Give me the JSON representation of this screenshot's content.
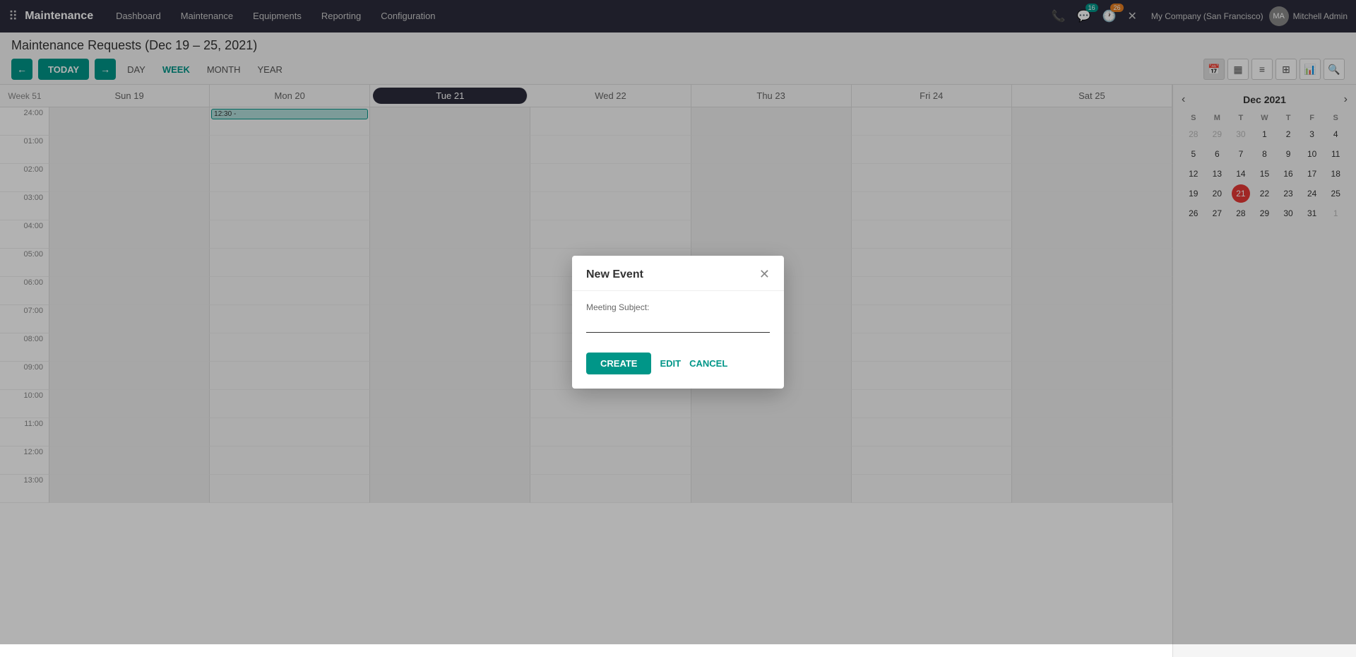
{
  "topnav": {
    "app_name": "Maintenance",
    "menu_items": [
      {
        "label": "Dashboard",
        "active": false
      },
      {
        "label": "Maintenance",
        "active": false
      },
      {
        "label": "Equipments",
        "active": false
      },
      {
        "label": "Reporting",
        "active": false
      },
      {
        "label": "Configuration",
        "active": false
      }
    ],
    "notification_count": "16",
    "chat_count": "26",
    "company": "My Company (San Francisco)",
    "user": "Mitchell Admin"
  },
  "page": {
    "title": "Maintenance Requests (Dec 19 – 25, 2021)",
    "views": [
      "DAY",
      "WEEK",
      "MONTH",
      "YEAR"
    ],
    "active_view": "WEEK"
  },
  "calendar": {
    "week_label": "Week 51",
    "days": [
      {
        "label": "Sun 19",
        "today": false
      },
      {
        "label": "Mon 20",
        "today": false
      },
      {
        "label": "Tue 21",
        "today": true
      },
      {
        "label": "Wed 22",
        "today": false
      },
      {
        "label": "Thu 23",
        "today": false
      },
      {
        "label": "Fri 24",
        "today": false
      },
      {
        "label": "Sat 25",
        "today": false
      }
    ],
    "time_slots": [
      "24:00",
      "01:00",
      "02:00",
      "03:00",
      "04:00",
      "05:00",
      "06:00",
      "07:00",
      "08:00",
      "09:00",
      "10:00",
      "11:00",
      "12:00",
      "13:00"
    ],
    "event": {
      "time": "12:30 -",
      "col": 1,
      "row": 0
    }
  },
  "mini_calendar": {
    "title": "Dec 2021",
    "day_headers": [
      "S",
      "M",
      "T",
      "W",
      "T",
      "F",
      "S"
    ],
    "weeks": [
      [
        {
          "day": "28",
          "other": true
        },
        {
          "day": "29",
          "other": true
        },
        {
          "day": "30",
          "other": true
        },
        {
          "day": "1",
          "other": false
        },
        {
          "day": "2",
          "other": false
        },
        {
          "day": "3",
          "other": false
        },
        {
          "day": "4",
          "other": false
        }
      ],
      [
        {
          "day": "5",
          "other": false
        },
        {
          "day": "6",
          "other": false
        },
        {
          "day": "7",
          "other": false
        },
        {
          "day": "8",
          "other": false
        },
        {
          "day": "9",
          "other": false
        },
        {
          "day": "10",
          "other": false
        },
        {
          "day": "11",
          "other": false
        }
      ],
      [
        {
          "day": "12",
          "other": false
        },
        {
          "day": "13",
          "other": false
        },
        {
          "day": "14",
          "other": false
        },
        {
          "day": "15",
          "other": false
        },
        {
          "day": "16",
          "other": false
        },
        {
          "day": "17",
          "other": false
        },
        {
          "day": "18",
          "other": false
        }
      ],
      [
        {
          "day": "19",
          "other": false
        },
        {
          "day": "20",
          "other": false
        },
        {
          "day": "21",
          "other": false,
          "today": true
        },
        {
          "day": "22",
          "other": false
        },
        {
          "day": "23",
          "other": false
        },
        {
          "day": "24",
          "other": false
        },
        {
          "day": "25",
          "other": false
        }
      ],
      [
        {
          "day": "26",
          "other": false
        },
        {
          "day": "27",
          "other": false
        },
        {
          "day": "28",
          "other": false
        },
        {
          "day": "29",
          "other": false
        },
        {
          "day": "30",
          "other": false
        },
        {
          "day": "31",
          "other": false
        },
        {
          "day": "1",
          "other": true
        }
      ]
    ]
  },
  "modal": {
    "title": "New Event",
    "meeting_subject_label": "Meeting Subject:",
    "meeting_subject_value": "",
    "create_label": "CREATE",
    "edit_label": "EDIT",
    "cancel_label": "CANCEL"
  }
}
